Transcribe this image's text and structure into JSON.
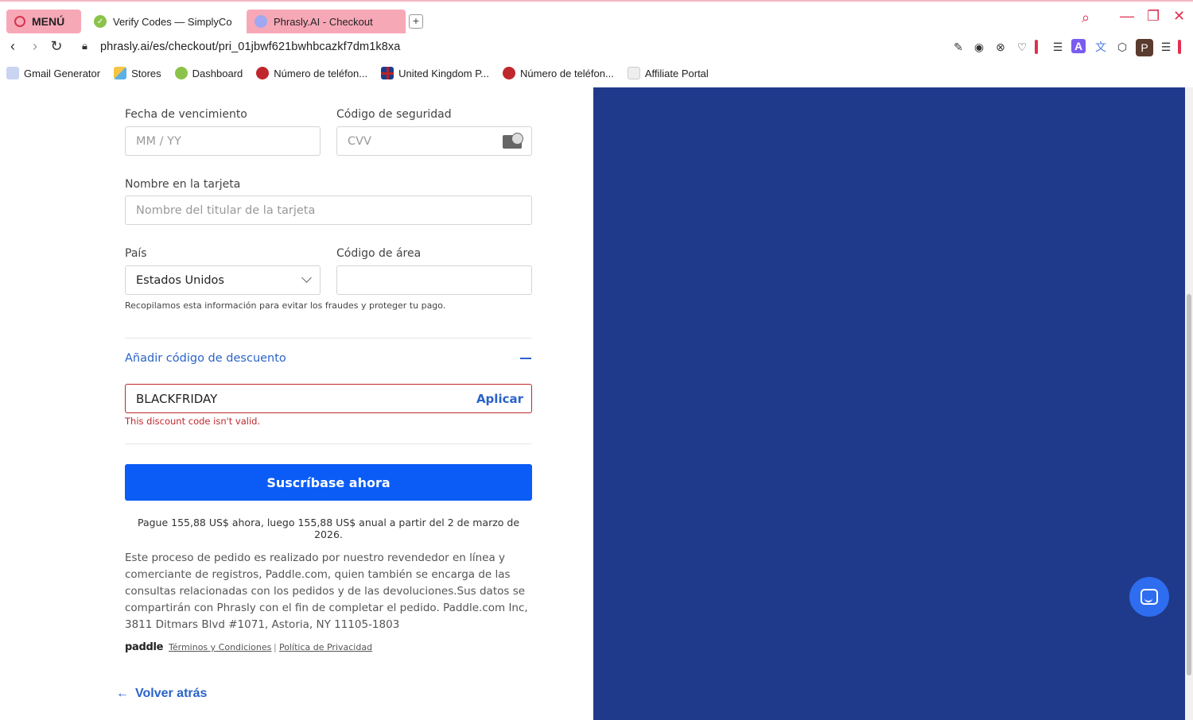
{
  "browser": {
    "menu_label": "MENÚ",
    "tabs": [
      {
        "title": "Verify Codes — SimplyCo"
      },
      {
        "title": "Phrasly.AI - Checkout"
      }
    ],
    "new_tab": "+",
    "url": "phrasly.ai/es/checkout/pri_01jbwf621bwhbcazkf7dm1k8xa",
    "profile_initial": "P",
    "bookmarks": [
      {
        "label": "Gmail Generator"
      },
      {
        "label": "Stores"
      },
      {
        "label": "Dashboard"
      },
      {
        "label": "Número de teléfon..."
      },
      {
        "label": "United Kingdom P..."
      },
      {
        "label": "Número de teléfon..."
      },
      {
        "label": "Affiliate Portal"
      }
    ]
  },
  "form": {
    "expiry_label": "Fecha de vencimiento",
    "expiry_placeholder": "MM / YY",
    "cvv_label": "Código de seguridad",
    "cvv_placeholder": "CVV",
    "name_label": "Nombre en la tarjeta",
    "name_placeholder": "Nombre del titular de la tarjeta",
    "country_label": "País",
    "country_value": "Estados Unidos",
    "area_label": "Código de área",
    "area_value": "",
    "fraud_note": "Recopilamos esta información para evitar los fraudes y proteger tu pago.",
    "discount_toggle": "Añadir código de descuento",
    "discount_value": "BLACKFRIDAY",
    "apply_label": "Aplicar",
    "discount_error": "This discount code isn't valid.",
    "submit_label": "Suscríbase ahora",
    "payment_note": "Pague 155,88 US$ ahora, luego 155,88 US$ anual a partir del 2 de marzo de 2026.",
    "legal_text": "Este proceso de pedido es realizado por nuestro revendedor en línea y comerciante de registros, Paddle.com, quien también se encarga de las consultas relacionadas con los pedidos y de las devoluciones.Sus datos se compartirán con Phrasly con el fin de completar el pedido. Paddle.com Inc, 3811 Ditmars Blvd #1071, Astoria, NY 11105-1803",
    "paddle_logo": "paddle",
    "terms_link": "Términos y Condiciones",
    "privacy_link": "Política de Privacidad",
    "back_label": "Volver atrás"
  },
  "colors": {
    "panel": "#1f3a8a",
    "primary": "#0b5cf6",
    "link": "#2a63c9",
    "error": "#c0272d",
    "accent": "#f7a8b7"
  },
  "icons": [
    "opera-icon",
    "back-icon",
    "forward-icon",
    "reload-icon",
    "lock-icon",
    "search-icon",
    "chat-icon",
    "arrow-left-icon",
    "chevron-down-icon",
    "minus-icon",
    "card-cvv-icon"
  ]
}
